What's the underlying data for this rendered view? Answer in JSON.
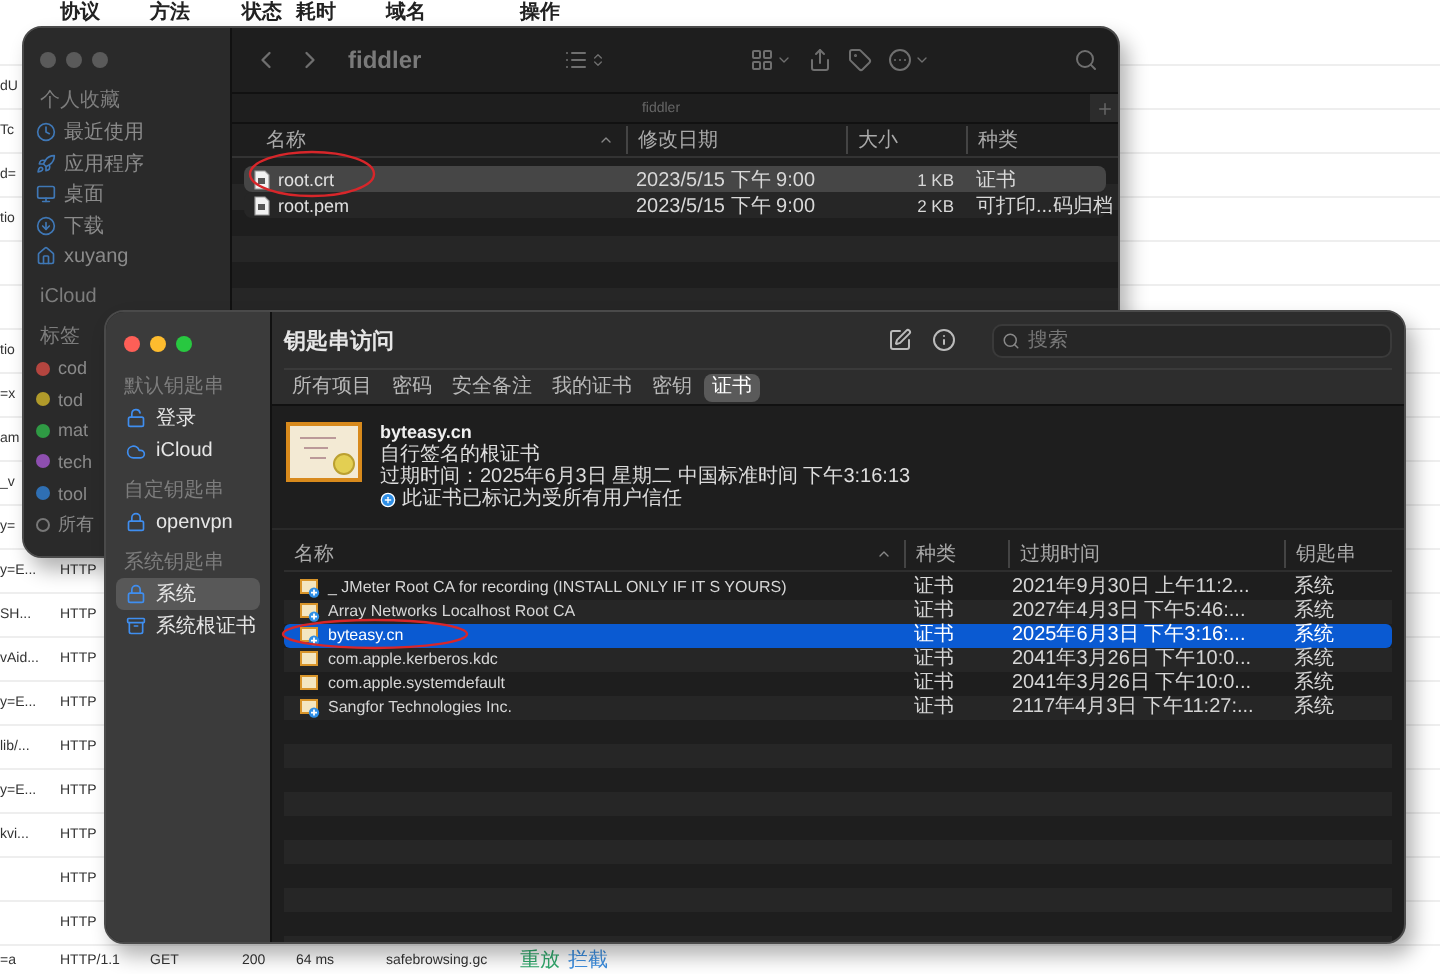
{
  "background_table": {
    "columns": [
      "协议",
      "方法",
      "状态",
      "耗时",
      "域名",
      "操作"
    ],
    "rows": [
      {
        "column_1": "dU"
      },
      {
        "column_1": "Tc"
      },
      {
        "column_1": "d="
      },
      {
        "column_1": "tio"
      },
      {},
      {},
      {
        "column_1": "tio"
      },
      {
        "column_1": "=x"
      },
      {
        "column_1": "am"
      },
      {
        "column_1": "_v"
      },
      {
        "column_1": "y="
      },
      {
        "column_1": "y=E...",
        "protocol": "HTTP"
      },
      {
        "column_1": "SH...",
        "protocol": "HTTP"
      },
      {
        "column_1": "vAid...",
        "protocol": "HTTP"
      },
      {
        "column_1": "y=E...",
        "protocol": "HTTP"
      },
      {
        "column_1": "lib/...",
        "protocol": "HTTP"
      },
      {
        "column_1": "y=E...",
        "protocol": "HTTP"
      },
      {
        "column_1": "kvi...",
        "protocol": "HTTP"
      },
      {
        "protocol": "HTTP"
      },
      {
        "protocol": "HTTP"
      },
      {
        "column_1": "=a",
        "protocol": "HTTP/1.1",
        "method": "GET",
        "status": "200",
        "duration": "64 ms",
        "domain": "safebrowsing.gc",
        "actions": [
          {
            "label": "重放",
            "color": "#2fa86b"
          },
          {
            "label": "拦截",
            "color": "#3d8fe0"
          }
        ]
      }
    ]
  },
  "finder": {
    "title": "fiddler",
    "path": "fiddler",
    "sidebar": [
      {
        "heading": "个人收藏",
        "items": [
          {
            "label": "最近使用",
            "kind": "clock"
          },
          {
            "label": "应用程序",
            "kind": "apps"
          },
          {
            "label": "桌面",
            "kind": "desktop"
          },
          {
            "label": "下载",
            "kind": "download"
          },
          {
            "label": "xuyang",
            "kind": "home"
          }
        ]
      },
      {
        "heading": "iCloud"
      },
      {
        "heading": "标签",
        "items": [
          {
            "label": "cod",
            "kind": "tag",
            "color": "#b4453f"
          },
          {
            "label": "tod",
            "kind": "tag",
            "color": "#b09a2a"
          },
          {
            "label": "mat",
            "kind": "tag",
            "color": "#2f9a44"
          },
          {
            "label": "tech",
            "kind": "tag",
            "color": "#8e4fb0"
          },
          {
            "label": "tool",
            "kind": "tag",
            "color": "#2f6fb3"
          },
          {
            "label": "所有",
            "kind": "all"
          }
        ]
      }
    ],
    "columns": [
      "名称",
      "修改日期",
      "大小",
      "种类"
    ],
    "files": [
      {
        "name": "root.crt",
        "modified": "2023/5/15 下午 9:00",
        "size": "1 KB",
        "type": "证书",
        "selected": true
      },
      {
        "name": "root.pem",
        "modified": "2023/5/15 下午 9:00",
        "size": "2 KB",
        "type": "可打印...码归档",
        "selected": false
      }
    ]
  },
  "keychain": {
    "title": "钥匙串访问",
    "search": {
      "placeholder": "搜索"
    },
    "sidebar": [
      {
        "heading": "默认钥匙串",
        "items": [
          {
            "label": "登录",
            "kind": "lock-open",
            "selected": false
          },
          {
            "label": "iCloud",
            "kind": "cloud",
            "selected": false
          }
        ]
      },
      {
        "heading": "自定钥匙串",
        "items": [
          {
            "label": "openvpn",
            "kind": "lock",
            "selected": false
          }
        ]
      },
      {
        "heading": "系统钥匙串",
        "items": [
          {
            "label": "系统",
            "kind": "lock",
            "selected": true
          },
          {
            "label": "系统根证书",
            "kind": "cabinet",
            "selected": false
          }
        ]
      }
    ],
    "tabs": [
      {
        "label": "所有项目",
        "selected": false
      },
      {
        "label": "密码",
        "selected": false
      },
      {
        "label": "安全备注",
        "selected": false
      },
      {
        "label": "我的证书",
        "selected": false
      },
      {
        "label": "密钥",
        "selected": false
      },
      {
        "label": "证书",
        "selected": true
      }
    ],
    "detail": {
      "name": "byteasy.cn",
      "subtitle": "自行签名的根证书",
      "expiry": "过期时间：2025年6月3日 星期二 中国标准时间 下午3:16:13",
      "trust": "此证书已标记为受所有用户信任"
    },
    "columns": [
      "名称",
      "种类",
      "过期时间",
      "钥匙串"
    ],
    "rows": [
      {
        "name": "_ JMeter Root CA for recording (INSTALL ONLY IF IT S YOURS)",
        "type": "证书",
        "expires": "2021年9月30日 上午11:2...",
        "keychain": "系统",
        "selected": false,
        "badge": true
      },
      {
        "name": "Array Networks Localhost Root CA",
        "type": "证书",
        "expires": "2027年4月3日 下午5:46:...",
        "keychain": "系统",
        "selected": false,
        "badge": true
      },
      {
        "name": "byteasy.cn",
        "type": "证书",
        "expires": "2025年6月3日 下午3:16:...",
        "keychain": "系统",
        "selected": true,
        "badge": true
      },
      {
        "name": "com.apple.kerberos.kdc",
        "type": "证书",
        "expires": "2041年3月26日 下午10:0...",
        "keychain": "系统",
        "selected": false,
        "badge": false
      },
      {
        "name": "com.apple.systemdefault",
        "type": "证书",
        "expires": "2041年3月26日 下午10:0...",
        "keychain": "系统",
        "selected": false,
        "badge": false
      },
      {
        "name": "Sangfor Technologies Inc.",
        "type": "证书",
        "expires": "2117年4月3日 下午11:27:...",
        "keychain": "系统",
        "selected": false,
        "badge": true
      }
    ]
  }
}
